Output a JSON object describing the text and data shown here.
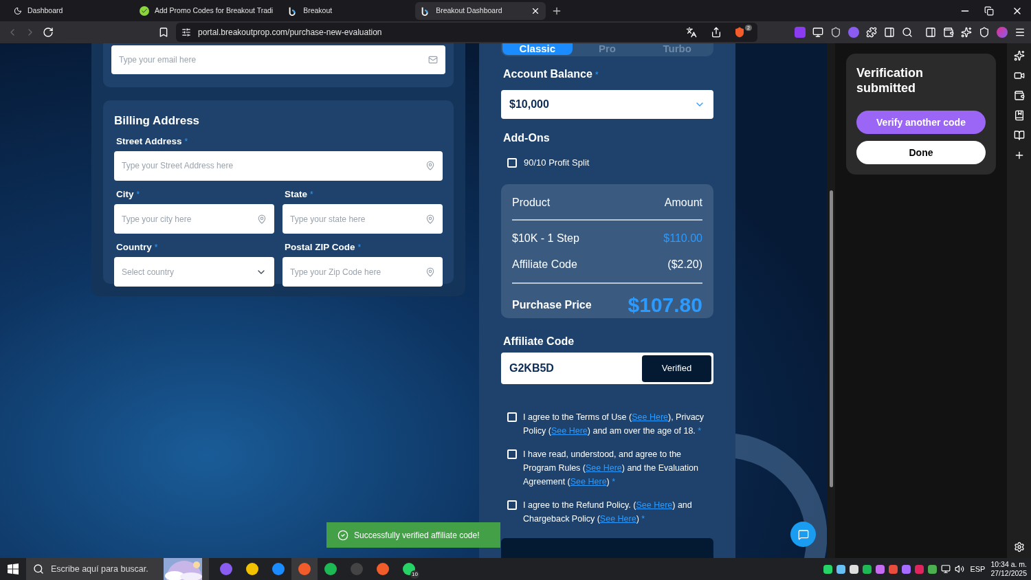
{
  "browser": {
    "tabs": [
      {
        "title": "Dashboard",
        "selected": false
      },
      {
        "title": "Add Promo Codes for Breakout Tradi",
        "selected": false
      },
      {
        "title": "Breakout",
        "selected": false
      },
      {
        "title": "Breakout Dashboard",
        "selected": true
      }
    ],
    "url": "portal.breakoutprop.com/purchase-new-evaluation",
    "shield_badge": "2"
  },
  "email_field": {
    "placeholder": "Type your email here"
  },
  "billing": {
    "title": "Billing Address",
    "mark": "*",
    "fields": [
      {
        "label": "Street Address",
        "placeholder": "Type your Street Address here",
        "kind": "text"
      },
      {
        "label": "City",
        "placeholder": "Type your city here",
        "kind": "text"
      },
      {
        "label": "State",
        "placeholder": "Type your state here",
        "kind": "text"
      },
      {
        "label": "Country",
        "placeholder": "Select country",
        "kind": "select"
      },
      {
        "label": "Postal ZIP Code",
        "placeholder": "Type your Zip Code here",
        "kind": "text"
      }
    ]
  },
  "plan_tabs": [
    {
      "label": "Classic",
      "selected": true
    },
    {
      "label": "Pro",
      "selected": false
    },
    {
      "label": "Turbo",
      "selected": false
    }
  ],
  "account_balance": {
    "label": "Account Balance",
    "mark": "*",
    "value": "$10,000"
  },
  "addons": {
    "title": "Add-Ons",
    "items": [
      {
        "label": "90/10 Profit Split",
        "checked": false
      }
    ]
  },
  "summary": {
    "columns": [
      "Product",
      "Amount"
    ],
    "rows": [
      {
        "name": "$10K - 1 Step",
        "amount": "$110.00",
        "highlight": true
      },
      {
        "name": "Affiliate Code",
        "amount": "($2.20)",
        "highlight": false
      }
    ],
    "total_label": "Purchase Price",
    "total": "$107.80"
  },
  "affiliate": {
    "title": "Affiliate Code",
    "value": "G2KB5D",
    "button": "Verified"
  },
  "agreements": [
    {
      "checked": false,
      "mark": "*",
      "parts": [
        {
          "kind": "text",
          "text": "I agree to the Terms of Use ("
        },
        {
          "kind": "link",
          "text": "See Here"
        },
        {
          "kind": "text",
          "text": "), Privacy Policy ("
        },
        {
          "kind": "link",
          "text": "See Here"
        },
        {
          "kind": "text",
          "text": ") and am over the age of 18."
        }
      ]
    },
    {
      "checked": false,
      "mark": "*",
      "parts": [
        {
          "kind": "text",
          "text": "I have read, understood, and agree to the Program Rules ("
        },
        {
          "kind": "link",
          "text": "See Here"
        },
        {
          "kind": "text",
          "text": ") and the Evaluation Agreement ("
        },
        {
          "kind": "link",
          "text": "See Here"
        },
        {
          "kind": "text",
          "text": ")"
        }
      ]
    },
    {
      "checked": false,
      "mark": "*",
      "parts": [
        {
          "kind": "text",
          "text": "I agree to the Refund Policy. ("
        },
        {
          "kind": "link",
          "text": "See Here"
        },
        {
          "kind": "text",
          "text": ") and Chargeback Policy ("
        },
        {
          "kind": "link",
          "text": "See Here"
        },
        {
          "kind": "text",
          "text": ")"
        }
      ]
    }
  ],
  "toast": {
    "text": "Successfully verified affiliate code!"
  },
  "side_panel": {
    "title": "Verification submitted",
    "buttons": [
      {
        "label": "Verify another code",
        "kind": "primary"
      },
      {
        "label": "Done",
        "kind": "secondary"
      }
    ]
  },
  "taskbar": {
    "search_placeholder": "Escribe aquí para buscar.",
    "whatsapp_badge": "10",
    "language": "ESP",
    "time": "10:34 a. m.",
    "date": "27/12/2025"
  }
}
